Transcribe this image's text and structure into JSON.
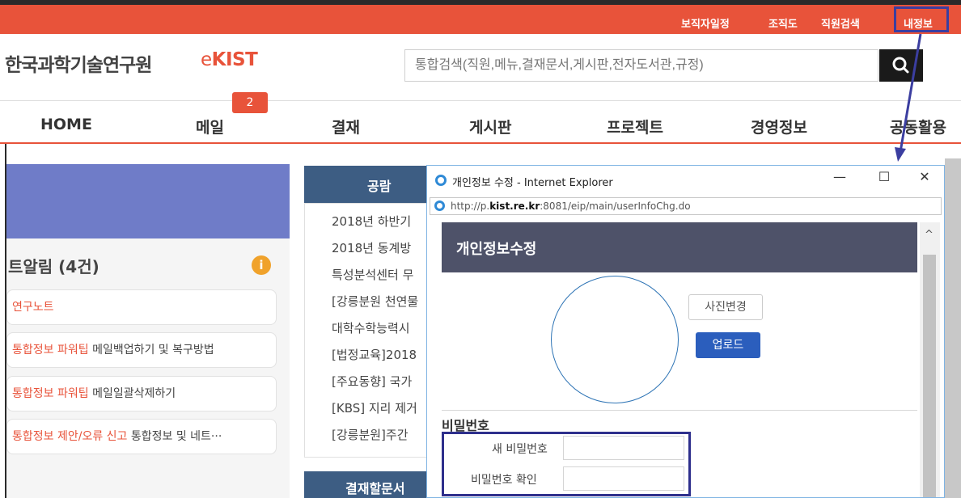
{
  "top_links": [
    "보직자일정",
    "조직도",
    "직원검색",
    "내정보"
  ],
  "brand": {
    "name": "한국과학기술연구원",
    "logo_e": "e",
    "logo_kist": "KIST"
  },
  "search": {
    "placeholder": "통합검색(직원,메뉴,결재문서,게시판,전자도서관,규정)",
    "icon": "search-icon"
  },
  "nav": {
    "items": [
      "HOME",
      "메일",
      "결재",
      "게시판",
      "프로젝트",
      "경영정보",
      "공동활용"
    ],
    "mail_badge": "2"
  },
  "left_panel": {
    "title": "트알림 (4건)",
    "info_icon": "i",
    "notes": [
      {
        "tag": "연구노트",
        "text": ""
      },
      {
        "tag": "통합정보 파워팁",
        "text": "메일백업하기 및 복구방법"
      },
      {
        "tag": "통합정보 파워팁",
        "text": "메일일괄삭제하기"
      },
      {
        "tag": "통합정보 제안/오류 신고",
        "text": "통합정보 및 네트···"
      }
    ]
  },
  "middle_panel": {
    "header": "공람",
    "items": [
      "2018년 하반기",
      "2018년 동계방",
      "특성분석센터 무",
      "[강릉분원 천연물",
      "대학수학능력시",
      "[법정교육]2018",
      "[주요동향] 국가",
      "[KBS] 지리 제거",
      "[강릉분원]주간"
    ],
    "header2": "결재할문서"
  },
  "popup": {
    "window_title": "개인정보 수정 - Internet Explorer",
    "controls": {
      "minimize": "—",
      "maximize": "☐",
      "close": "✕"
    },
    "address": {
      "prefix": "http://p.",
      "host": "kist.re.kr",
      "suffix": ":8081/eip/main/userInfoChg.do"
    },
    "page_title": "개인정보수정",
    "photo_change": "사진변경",
    "upload": "업로드",
    "password_section": "비밀번호",
    "new_password_label": "새 비밀번호",
    "confirm_password_label": "비밀번호 확인",
    "scroll_up": "^"
  },
  "colors": {
    "accent": "#e8533a",
    "navy": "#3d5d83",
    "highlight_box": "#2e2f8c",
    "upload_blue": "#2b5ebd"
  }
}
